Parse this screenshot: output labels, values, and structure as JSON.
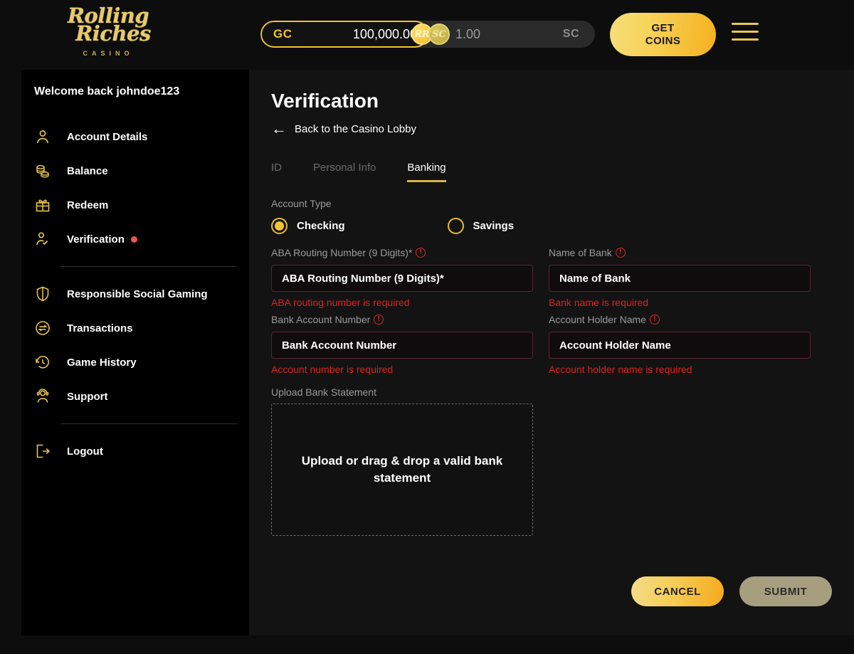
{
  "brand": {
    "script_line1": "Rolling",
    "script_line2": "Riches",
    "subtitle": "CASINO"
  },
  "topbar": {
    "gc_tag": "GC",
    "gc_amount": "100,000.00",
    "gc_coin_glyph": "RR",
    "sc_coin_glyph": "SC",
    "sc_amount": "1.00",
    "sc_tag": "SC",
    "get_coins_line1": "GET",
    "get_coins_line2": "COINS"
  },
  "sidebar": {
    "welcome": "Welcome back johndoe123",
    "items": [
      {
        "label": "Account Details",
        "icon": "user-icon",
        "badge": ""
      },
      {
        "label": "Balance",
        "icon": "coins-stack-icon",
        "badge": ""
      },
      {
        "label": "Redeem",
        "icon": "gift-icon",
        "badge": ""
      },
      {
        "label": "Verification",
        "icon": "user-check-icon",
        "badge": "dot"
      },
      {
        "label": "Responsible Social Gaming",
        "icon": "shield-icon",
        "badge": ""
      },
      {
        "label": "Transactions",
        "icon": "exchange-arrows-icon",
        "badge": ""
      },
      {
        "label": "Game History",
        "icon": "clock-history-icon",
        "badge": ""
      },
      {
        "label": "Support",
        "icon": "headset-agent-icon",
        "badge": ""
      },
      {
        "label": "Logout",
        "icon": "logout-icon",
        "badge": ""
      }
    ]
  },
  "main": {
    "title": "Verification",
    "back_link": "Back to the Casino Lobby",
    "tabs": [
      {
        "label": "ID",
        "active": false
      },
      {
        "label": "Personal Info",
        "active": false
      },
      {
        "label": "Banking",
        "active": true
      }
    ],
    "account_type_label": "Account Type",
    "account_type_options": [
      {
        "label": "Checking",
        "selected": true
      },
      {
        "label": "Savings",
        "selected": false
      }
    ],
    "fields": [
      {
        "label": "ABA Routing Number (9 Digits)*",
        "placeholder": "ABA Routing Number (9 Digits)*",
        "value": "",
        "error": "ABA routing number is required"
      },
      {
        "label": "Name of Bank",
        "placeholder": "Name of Bank",
        "value": "",
        "error": "Bank name is required"
      },
      {
        "label": "Bank Account Number",
        "placeholder": "Bank Account Number",
        "value": "",
        "error": "Account number is required"
      },
      {
        "label": "Account Holder Name",
        "placeholder": "Account Holder Name",
        "value": "",
        "error": "Account holder name is required"
      }
    ],
    "upload_label": "Upload Bank Statement",
    "dropzone_text": "Upload or drag & drop a valid bank statement",
    "cancel_label": "CANCEL",
    "submit_label": "SUBMIT"
  },
  "colors": {
    "gold": "#f0c330",
    "gold_soft": "#e4c24e",
    "error_red": "#e02020",
    "badge_red": "#ef5350",
    "sidebar_bg": "#000000",
    "main_bg": "#131313",
    "submit_disabled": "#a79e7f"
  }
}
